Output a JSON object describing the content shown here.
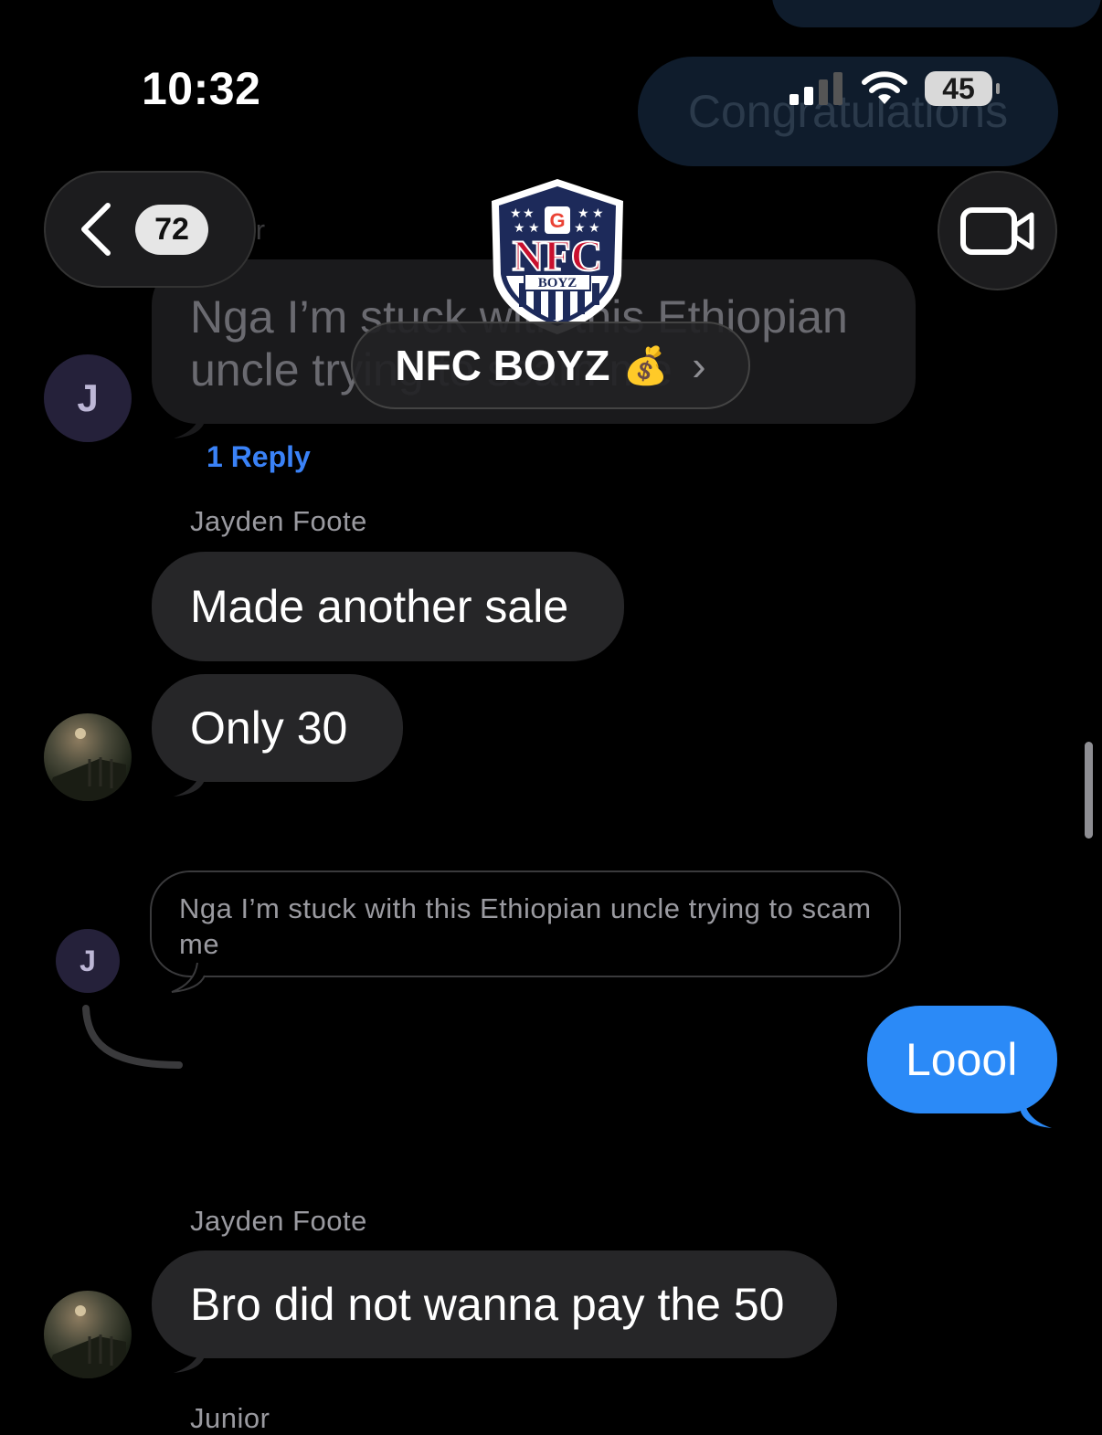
{
  "status_bar": {
    "time": "10:32",
    "battery": "45"
  },
  "nav": {
    "back_count": "72",
    "group_name": "NFC BOYZ",
    "group_emoji": "💰",
    "group_chevron": "›",
    "logo_text": "NFC",
    "logo_sub": "BOYZ"
  },
  "messages": {
    "faded_sent": "Congratulations",
    "faded_sender_fragment": "or",
    "thread_original": "Nga I’m stuck with this Ethiopian uncle trying to scam me",
    "thread_original_line1": "Nga I’m stuck with this Ethiopian",
    "thread_original_line2": "uncle trying to scam me",
    "reply_count": "1 Reply",
    "sender_1": "Jayden Foote",
    "msg_1": "Made another sale",
    "msg_2": "Only 30",
    "quoted": "Nga I’m stuck with this Ethiopian uncle trying to scam me",
    "sent_1": "Loool",
    "sender_2": "Jayden Foote",
    "msg_3": "Bro did not wanna pay the 50",
    "sender_3_partial": "Junior",
    "avatar_initial": "J"
  },
  "colors": {
    "background": "#000000",
    "incoming_bubble": "#262628",
    "outgoing_bubble": "#2b8af7",
    "reply_link": "#3a82f7",
    "sender_name": "#9a9aa0"
  }
}
